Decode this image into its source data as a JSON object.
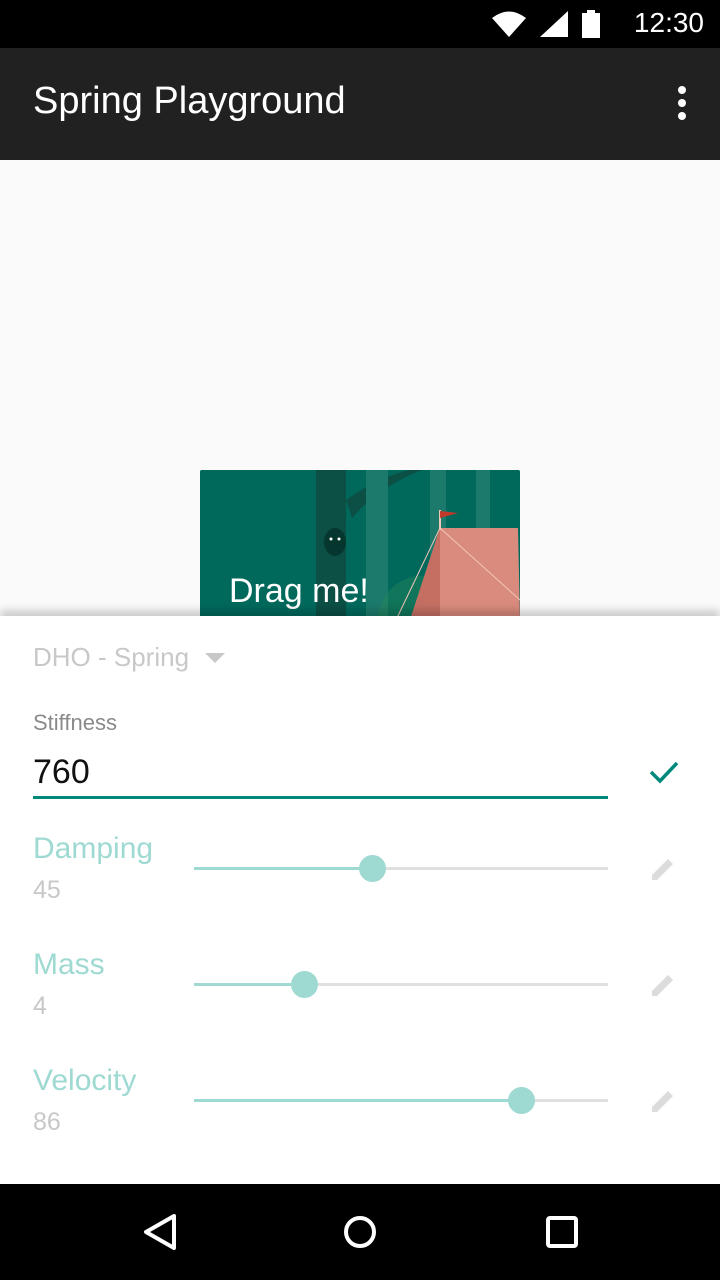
{
  "status_bar": {
    "time": "12:30",
    "icons": [
      "wifi-icon",
      "signal-icon",
      "battery-icon"
    ]
  },
  "app_bar": {
    "title": "Spring Playground",
    "menu_icon": "more-vert-icon"
  },
  "card": {
    "label": "Drag me!"
  },
  "controls": {
    "mode": "DHO - Spring",
    "stiffness": {
      "label": "Stiffness",
      "value": "760"
    },
    "params": [
      {
        "name": "Damping",
        "value": "45",
        "fraction": 0.43
      },
      {
        "name": "Mass",
        "value": "4",
        "fraction": 0.265
      },
      {
        "name": "Velocity",
        "value": "86",
        "fraction": 0.79
      }
    ]
  },
  "nav": [
    "back-icon",
    "home-icon",
    "recents-icon"
  ],
  "colors": {
    "accent": "#00897b",
    "slider": "#9ed9d2",
    "appbar": "#212121"
  }
}
